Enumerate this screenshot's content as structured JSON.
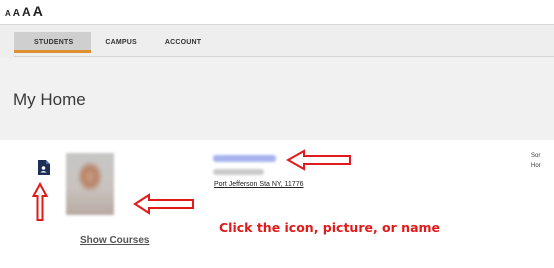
{
  "font_size_options": [
    "A",
    "A",
    "A",
    "A"
  ],
  "tabs": [
    {
      "label": "STUDENTS",
      "active": true
    },
    {
      "label": "CAMPUS",
      "active": false
    },
    {
      "label": "ACCOUNT",
      "active": false
    }
  ],
  "page_title": "My Home",
  "student": {
    "address": "Port Jefferson Sta NY, 11776",
    "show_courses_label": "Show Courses"
  },
  "instruction": "Click the icon, picture, or name",
  "right_column": [
    "Sor",
    "Hor"
  ],
  "colors": {
    "accent_orange": "#e0912f",
    "annotation_red": "#e11a1a",
    "icon_navy": "#1b2f57"
  },
  "icons": [
    "student-profile-icon",
    "red-arrow-up",
    "red-arrow-left",
    "red-arrow-left"
  ]
}
